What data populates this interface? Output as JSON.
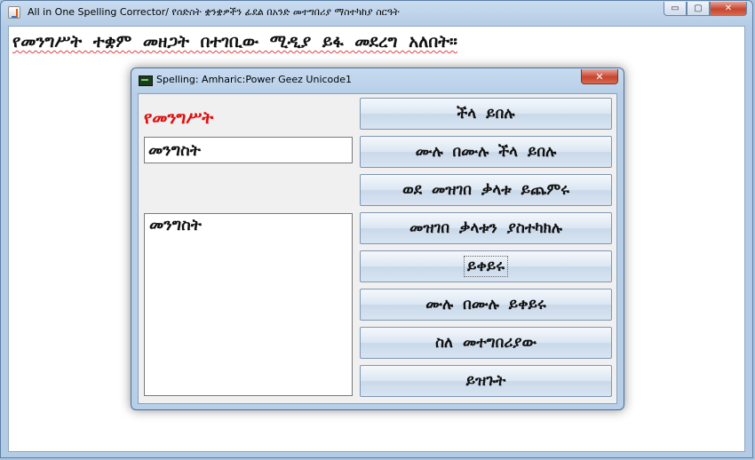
{
  "window": {
    "title": "All in One Spelling Corrector/ የሰድስት ቋንቋዎችን ፊደል  በአንድ መተግበሪያ ማስተካከያ ስርዓት",
    "controls": {
      "minimize": "▭",
      "maximize": "▢",
      "close": "✕"
    }
  },
  "document": {
    "text": "የመንግሥት ተቋም መዘጋት በተገቢው ሚዲያ ይፋ መደረግ አለበት።"
  },
  "dialog": {
    "title": "Spelling: Amharic:Power Geez Unicode1",
    "close": "✕",
    "misspelled_word": "የመንግሥት",
    "change_to_value": "መንግስት",
    "suggestions": [
      "መንግስት"
    ],
    "buttons": {
      "ignore": "ችላ ይበሉ",
      "ignore_all": "ሙሉ በሙሉ ችላ ይበሉ",
      "add_to_dictionary": "ወደ መዝገበ ቃላቱ ይጨምሩ",
      "edit_dictionary": "መዝገበ ቃላቱን ያስተካክሉ",
      "change": "ይቀይሩ",
      "change_all": "ሙሉ በሙሉ ይቀይሩ",
      "about": "ስለ መተግበሪያው",
      "close": "ይዝጉት"
    }
  }
}
